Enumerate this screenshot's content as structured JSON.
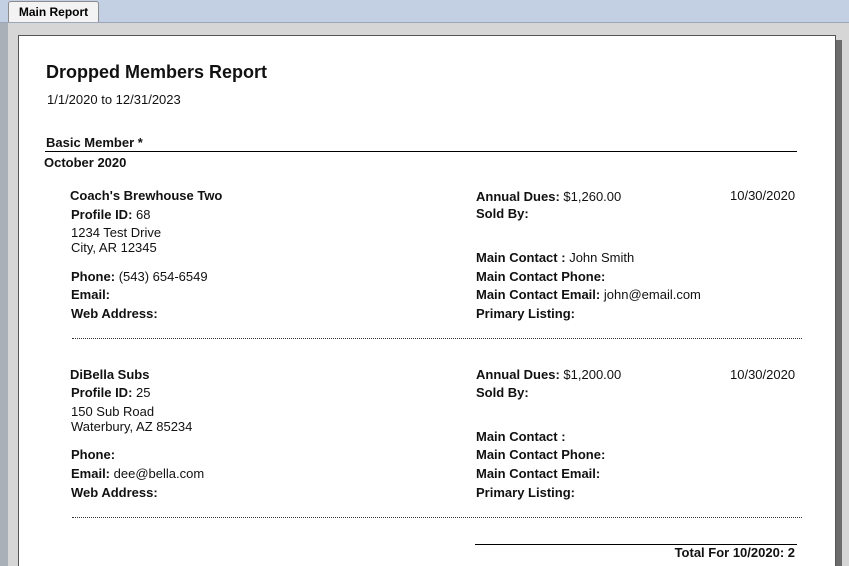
{
  "tab": {
    "label": "Main Report"
  },
  "report": {
    "title": "Dropped Members Report",
    "date_range": "1/1/2020 to 12/31/2023",
    "group": "Basic Member *",
    "month": "October 2020",
    "labels": {
      "profile_id": "Profile ID:",
      "phone": "Phone:",
      "email": "Email:",
      "web": "Web Address:",
      "annual_dues": "Annual Dues:",
      "sold_by": "Sold By:",
      "main_contact": "Main Contact :",
      "main_contact_phone": "Main Contact Phone:",
      "main_contact_email": "Main Contact Email:",
      "primary_listing": "Primary Listing:"
    },
    "members": [
      {
        "name": "Coach's Brewhouse Two",
        "profile_id": "68",
        "address1": "1234 Test Drive",
        "address2": "City, AR 12345",
        "phone": "(543) 654-6549",
        "email": "",
        "web": "",
        "annual_dues": "$1,260.00",
        "date": "10/30/2020",
        "sold_by": "",
        "main_contact": "John Smith",
        "main_contact_phone": "",
        "main_contact_email": "john@email.com",
        "primary_listing": ""
      },
      {
        "name": "DiBella Subs",
        "profile_id": "25",
        "address1": "150 Sub Road",
        "address2": "Waterbury, AZ 85234",
        "phone": "",
        "email": "dee@bella.com",
        "web": "",
        "annual_dues": "$1,200.00",
        "date": "10/30/2020",
        "sold_by": "",
        "main_contact": "",
        "main_contact_phone": "",
        "main_contact_email": "",
        "primary_listing": ""
      }
    ],
    "total": "Total For 10/2020: 2"
  }
}
